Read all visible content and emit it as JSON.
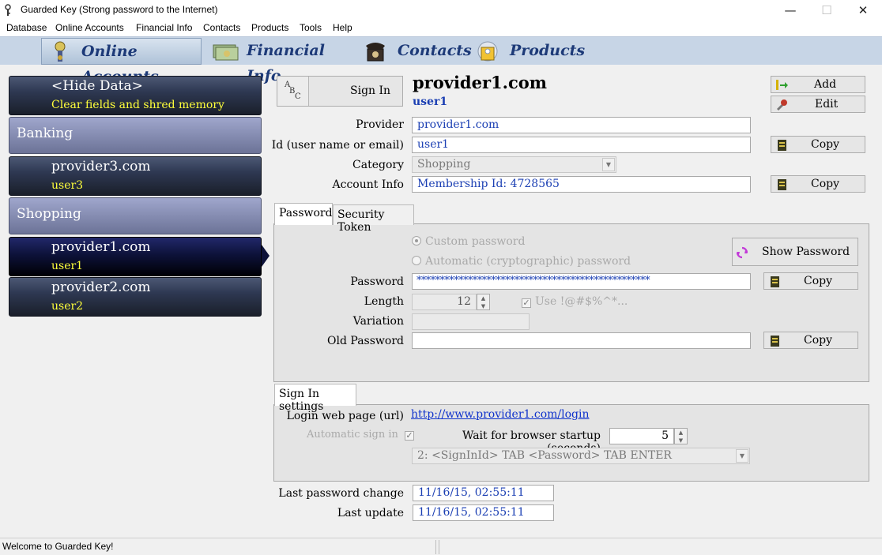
{
  "window": {
    "title": "Guarded Key (Strong password to the Internet)",
    "minimize": "—",
    "maximize": "☐",
    "close": "✕"
  },
  "menu": [
    "Database",
    "Online Accounts",
    "Financial Info",
    "Contacts",
    "Products",
    "Tools",
    "Help"
  ],
  "nav": {
    "online": "Online Accounts",
    "financial": "Financial Info",
    "contacts": "Contacts",
    "products": "Products"
  },
  "list": {
    "hide": {
      "title": "<Hide Data>",
      "subtitle": "Clear fields and shred memory"
    },
    "group_banking": "Banking",
    "provider3": {
      "name": "provider3.com",
      "user": "user3"
    },
    "group_shopping": "Shopping",
    "provider1": {
      "name": "provider1.com",
      "user": "user1"
    },
    "provider2": {
      "name": "provider2.com",
      "user": "user2"
    }
  },
  "header": {
    "sign_in_icon_text": "ABC",
    "sign_in_label": "Sign In",
    "provider_title": "provider1.com",
    "user_subtitle": "user1",
    "add_label": "Add",
    "edit_label": "Edit"
  },
  "fields": {
    "provider_label": "Provider",
    "provider_value": "provider1.com",
    "id_label": "Id (user name or email)",
    "id_value": "user1",
    "category_label": "Category",
    "category_value": "Shopping",
    "account_info_label": "Account Info",
    "account_info_value": "Membership Id: 4728565",
    "copy_label": "Copy"
  },
  "tabs": {
    "password": "Password",
    "security_token": "Security Token"
  },
  "password_panel": {
    "custom_password": "Custom password",
    "automatic_password": "Automatic (cryptographic) password",
    "show_password_label": "Show Password",
    "password_label": "Password",
    "password_value": "**************************************************",
    "length_label": "Length",
    "length_value": "12",
    "use_symbols_label": "Use !@#$%^*...",
    "variation_label": "Variation",
    "variation_value": "",
    "old_password_label": "Old Password",
    "old_password_value": ""
  },
  "signin_settings": {
    "tab_label": "Sign In settings",
    "login_url_label": "Login web page (url)",
    "login_url_value": "http://www.provider1.com/login",
    "auto_sign_in_label": "Automatic sign in",
    "wait_label": "Wait for browser startup (seconds)",
    "wait_value": "5",
    "sequence_value": "2: <SignInId> TAB <Password> TAB ENTER"
  },
  "dates": {
    "last_password_change_label": "Last password change",
    "last_password_change_value": "11/16/15, 02:55:11",
    "last_update_label": "Last update",
    "last_update_value": "11/16/15, 02:55:11"
  },
  "status": {
    "text": "Welcome to Guarded Key!"
  }
}
